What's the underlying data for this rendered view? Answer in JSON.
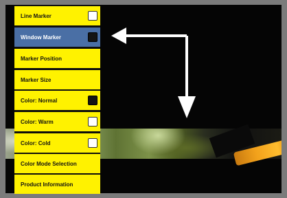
{
  "menu": {
    "items": [
      {
        "label": "Line Marker",
        "checkbox": "white",
        "selected": false
      },
      {
        "label": "Window Marker",
        "checkbox": "black",
        "selected": true
      },
      {
        "label": "Marker Position",
        "checkbox": "",
        "selected": false
      },
      {
        "label": "Marker Size",
        "checkbox": "",
        "selected": false
      },
      {
        "label": "Color: Normal",
        "checkbox": "black",
        "selected": false
      },
      {
        "label": "Color: Warm",
        "checkbox": "white",
        "selected": false
      },
      {
        "label": "Color: Cold",
        "checkbox": "white",
        "selected": false
      },
      {
        "label": "Color Mode Selection",
        "checkbox": "",
        "selected": false
      },
      {
        "label": "Product Information",
        "checkbox": "",
        "selected": false
      }
    ]
  },
  "colors": {
    "menu_item": "#fff200",
    "menu_selected": "#4a6fa5",
    "background": "#050505",
    "frame": "#7b7b7b",
    "arrow": "#ffffff"
  },
  "icons": {
    "arrow_left": "arrow-left-icon",
    "arrow_down": "arrow-down-icon"
  }
}
